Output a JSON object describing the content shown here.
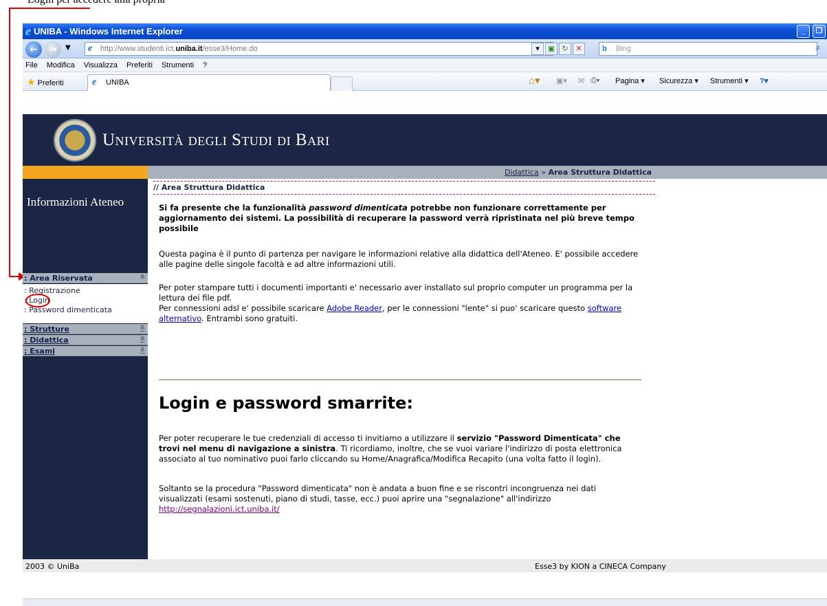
{
  "annotation": {
    "caption": "Login per accedere alla propria"
  },
  "window": {
    "title": "UNIBA - Windows Internet Explorer"
  },
  "address": {
    "url_prefix": "http://www.studenti.ict.",
    "url_domain": "uniba.it",
    "url_suffix": "/esse3/Home.do",
    "search_placeholder": "Bing"
  },
  "menu": [
    "File",
    "Modifica",
    "Visualizza",
    "Preferiti",
    "Strumenti",
    "?"
  ],
  "favbar": {
    "favorites_label": "Preferiti",
    "tab_label": "UNIBA",
    "commands": [
      "Pagina ▾",
      "Sicurezza ▾",
      "Strumenti ▾"
    ]
  },
  "banner": {
    "title": "Università degli Studi di Bari"
  },
  "breadcrumb": {
    "link": "Didattica",
    "separator": "»",
    "current": "Area Struttura Didattica"
  },
  "sidebar": {
    "title": "Informazioni Ateneo",
    "area_riservata": ": Area Riservata",
    "links": [
      ": Registrazione",
      ": Login",
      ": Password dimenticata"
    ],
    "strutture": ": Strutture",
    "didattica": ": Didattica",
    "esami": ": Esami"
  },
  "content": {
    "area_title": "// Area Struttura Didattica",
    "notice_1": "Si fa presente che la funzionalità ",
    "notice_italic": "password dimenticata",
    "notice_2": " potrebbe non funzionare correttamente per aggiornamento dei sistemi. La possibilità di recuperare la password verrà ripristinata nel più breve tempo possibile",
    "intro": "Questa pagina è il punto di partenza per navigare le informazioni relative alla didattica dell'Ateneo. E' possibile accedere alle pagine delle singole facoltà e ad altre informazioni utili.",
    "pdf_1": "Per poter stampare tutti i documenti importanti e' necessario aver installato sul proprio computer un programma per la lettura dei file pdf.",
    "pdf_2a": "Per connessioni adsl e' possibile scaricare ",
    "pdf_link1": "Adobe Reader",
    "pdf_2b": ", per le connessioni \"lente\" si puo' scaricare questo ",
    "pdf_link2": "software alternativo",
    "pdf_2c": ". Entrambi sono gratuiti.",
    "heading": "Login e password smarrite:",
    "recover_1": "Per poter recuperare le tue credenziali di accesso ti invitiamo a utilizzare il ",
    "recover_bold": "servizio \"Password Dimenticata\" che trovi nel menu di navigazione a sinistra",
    "recover_2": ". Ti ricordiamo, inoltre, che se vuoi variare l'indirizzo di posta elettronica associato al tuo nominativo puoi farlo cliccando su Home/Anagrafica/Modifica Recapito (una volta fatto il login).",
    "report_1": "Soltanto se la procedura \"Password dimenticata\" non è andata a buon fine e se riscontri incongruenza nei dati visualizzati (esami sostenuti, piano di studi, tasse, ecc.) puoi aprire una \"segnalazione\" all'indirizzo ",
    "report_link": "http://segnalazioni.ict.uniba.it/"
  },
  "footer": {
    "left": "2003 © UniBa",
    "right": "Esse3 by KION a CINECA Company"
  },
  "colors": {
    "navy": "#1a2644",
    "orange": "#f4a620",
    "annotation_red": "#e00000"
  }
}
